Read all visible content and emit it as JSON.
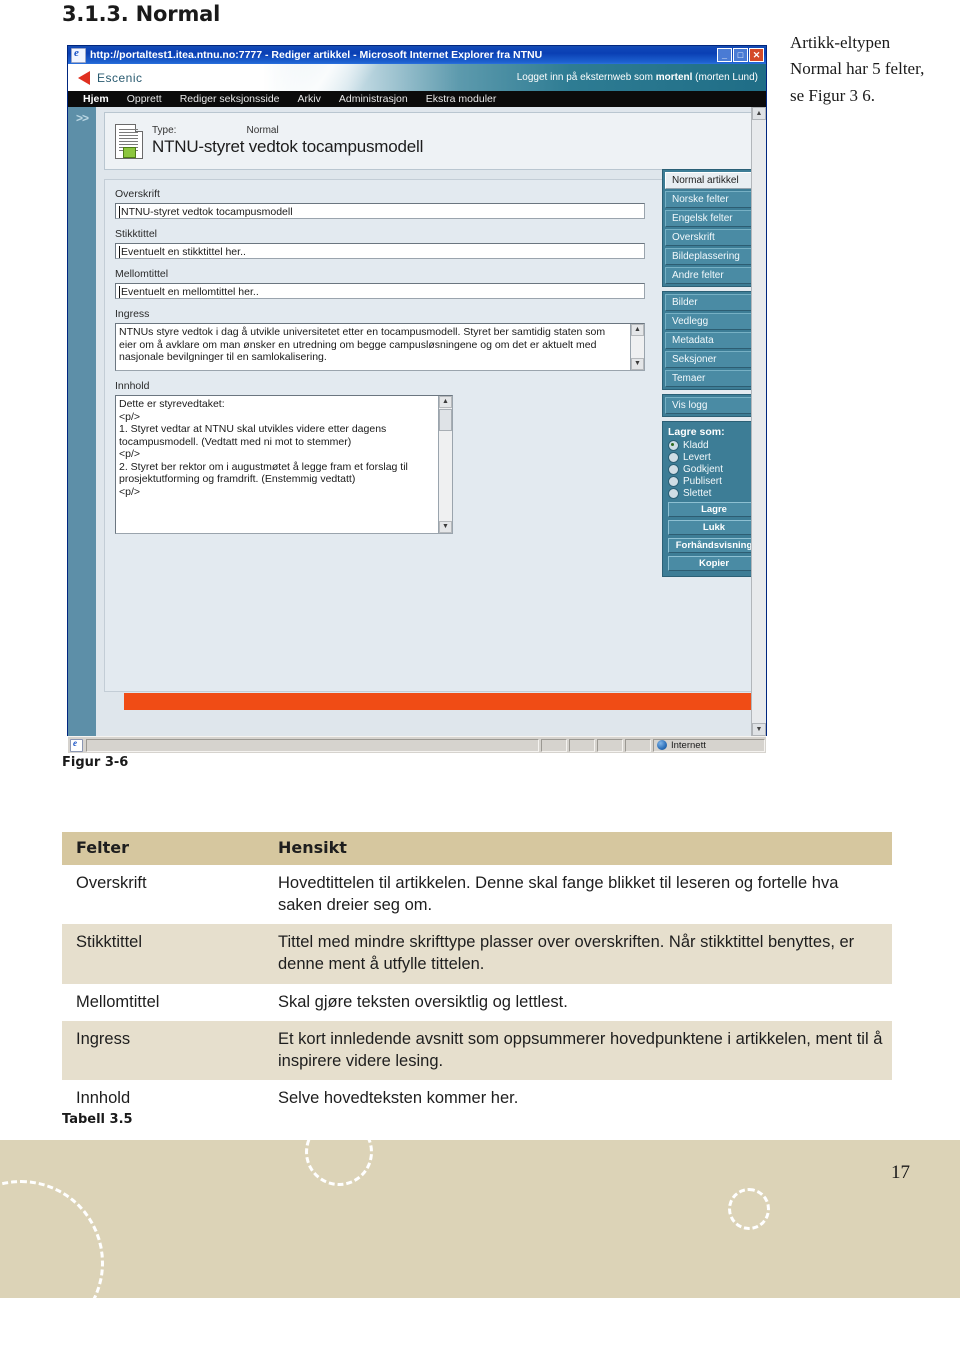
{
  "page": {
    "heading": "3.1.3. Normal",
    "margin_note": "Artikk-eltypen Normal har 5 felter, se Figur 3 6.",
    "figure_caption": "Figur 3-6",
    "table_label": "Tabell 3.5",
    "page_number": "17"
  },
  "browser": {
    "title": "http://portaltest1.itea.ntnu.no:7777 - Rediger artikkel - Microsoft Internet Explorer fra NTNU",
    "minimize_label": "_",
    "maximize_label": "□",
    "close_label": "✕",
    "status_zone": "Internett"
  },
  "app": {
    "logo_text": "Escenic",
    "login_info_prefix": "Logget inn på eksternweb som ",
    "login_user": "mortenl",
    "login_fullname": " (morten Lund)",
    "menu": [
      {
        "label": "Hjem",
        "active": true
      },
      {
        "label": "Opprett",
        "active": false
      },
      {
        "label": "Rediger seksjonsside",
        "active": false
      },
      {
        "label": "Arkiv",
        "active": false
      },
      {
        "label": "Administrasjon",
        "active": false
      },
      {
        "label": "Ekstra moduler",
        "active": false
      }
    ],
    "rail_label": ">>",
    "article": {
      "type_label": "Type:",
      "type_value": "Normal",
      "title": "NTNU-styret vedtok tocampusmodell"
    },
    "fields": {
      "overskrift": {
        "label": "Overskrift",
        "value": "NTNU-styret vedtok tocampusmodell"
      },
      "stikktittel": {
        "label": "Stikktittel",
        "value": "Eventuelt en stikktittel her.."
      },
      "mellomtittel": {
        "label": "Mellomtittel",
        "value": "Eventuelt en mellomtittel her.."
      },
      "ingress": {
        "label": "Ingress",
        "value": "NTNUs styre vedtok i dag å utvikle universitetet etter en tocampusmodell. Styret ber samtidig staten som eier om å avklare om man ønsker en utredning om begge campusløsningene og om det er aktuelt med nasjonale bevilgninger til en samlokalisering."
      },
      "innhold": {
        "label": "Innhold",
        "value": "Dette er styrevedtaket:\n<p/>\n1. Styret vedtar at NTNU skal utvikles videre etter dagens tocampusmodell. (Vedtatt med ni mot to stemmer)\n<p/>\n2. Styret ber rektor om i augustmøtet å legge fram et forslag til prosjektutforming og framdrift. (Enstemmig vedtatt)\n<p/>"
      }
    },
    "right_panel": {
      "group1": [
        {
          "label": "Normal artikkel",
          "selected": true
        },
        {
          "label": "Norske felter",
          "selected": false
        },
        {
          "label": "Engelsk felter",
          "selected": false
        },
        {
          "label": "Overskrift",
          "selected": false
        },
        {
          "label": "Bildeplassering",
          "selected": false
        },
        {
          "label": "Andre felter",
          "selected": false
        }
      ],
      "group2": [
        {
          "label": "Bilder",
          "selected": false
        },
        {
          "label": "Vedlegg",
          "selected": false
        },
        {
          "label": "Metadata",
          "selected": false
        },
        {
          "label": "Seksjoner",
          "selected": false
        },
        {
          "label": "Temaer",
          "selected": false
        }
      ],
      "group3": [
        {
          "label": "Vis logg",
          "selected": false
        }
      ],
      "save_as": {
        "title": "Lagre som:",
        "options": [
          {
            "label": "Kladd",
            "checked": true
          },
          {
            "label": "Levert",
            "checked": false
          },
          {
            "label": "Godkjent",
            "checked": false
          },
          {
            "label": "Publisert",
            "checked": false
          },
          {
            "label": "Slettet",
            "checked": false
          }
        ],
        "actions": [
          {
            "label": "Lagre"
          },
          {
            "label": "Lukk"
          },
          {
            "label": "Forhåndsvisning"
          },
          {
            "label": "Kopier"
          }
        ]
      }
    }
  },
  "table": {
    "headers": [
      "Felter",
      "Hensikt"
    ],
    "rows": [
      {
        "felter": "Overskrift",
        "hensikt": "Hovedtittelen til artikkelen. Denne skal fange blikket til leseren og fortelle hva saken dreier seg om.",
        "shaded": false
      },
      {
        "felter": "Stikktittel",
        "hensikt": "Tittel med mindre skrifttype plasser over overskriften. Når stikktittel benyttes, er denne ment å utfylle tittelen.",
        "shaded": true
      },
      {
        "felter": "Mellomtittel",
        "hensikt": "Skal gjøre teksten oversiktlig og lettlest.",
        "shaded": false
      },
      {
        "felter": "Ingress",
        "hensikt": "Et kort innledende avsnitt som oppsummerer hovedpunktene i artikkelen, ment til å inspirere videre lesing.",
        "shaded": true
      },
      {
        "felter": "Innhold",
        "hensikt": "Selve hovedteksten kommer her.",
        "shaded": false
      }
    ]
  },
  "colors": {
    "titlebar_blue": "#0a3fb4",
    "escenic_teal": "#2e7c93",
    "panel_teal": "#4a8ba4",
    "orange_bar": "#f04c15",
    "table_header": "#d6c79f",
    "table_alt_row": "#e6dfcd",
    "footer_band": "#dcd3b7",
    "logo_red": "#e03020"
  }
}
